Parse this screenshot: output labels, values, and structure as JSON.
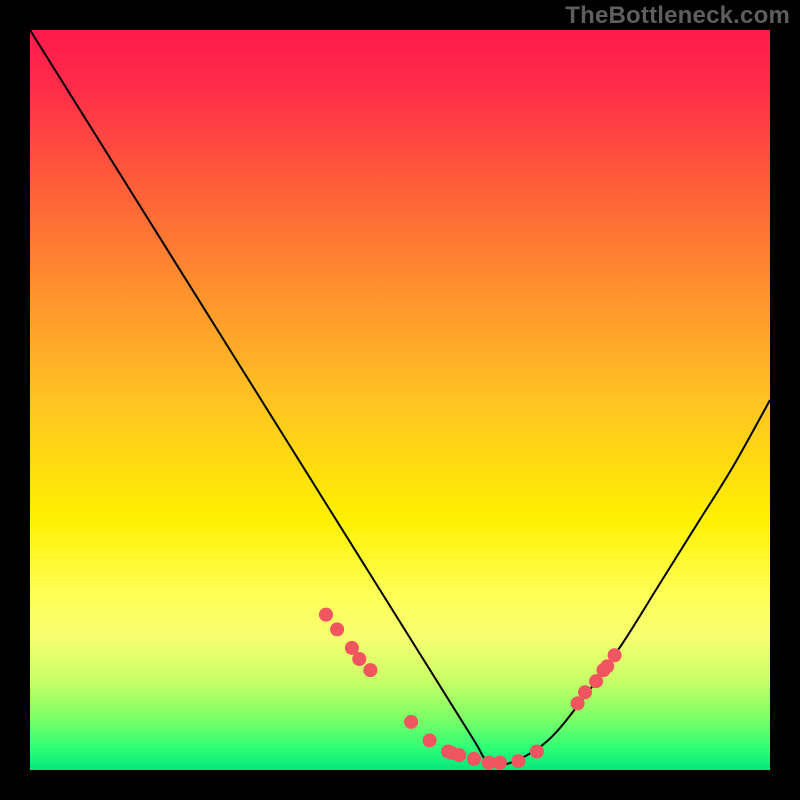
{
  "watermark": "TheBottleneck.com",
  "chart_data": {
    "type": "line",
    "title": "",
    "xlabel": "",
    "ylabel": "",
    "xlim": [
      0,
      100
    ],
    "ylim": [
      0,
      100
    ],
    "grid": false,
    "series": [
      {
        "name": "bottleneck-curve",
        "x": [
          0,
          5,
          10,
          15,
          20,
          25,
          30,
          35,
          40,
          45,
          50,
          55,
          60,
          62,
          65,
          70,
          75,
          80,
          85,
          90,
          95,
          100
        ],
        "values": [
          100,
          92,
          84,
          76,
          68,
          60,
          52,
          44,
          36,
          28,
          20,
          12,
          4,
          1,
          1,
          4,
          10,
          17,
          25,
          33,
          41,
          50
        ]
      }
    ],
    "markers": {
      "name": "highlight-dots",
      "color": "#f1555f",
      "x": [
        40.0,
        41.5,
        43.5,
        44.5,
        46.0,
        51.5,
        54.0,
        56.5,
        57.0,
        58.0,
        60.0,
        62.0,
        63.5,
        66.0,
        68.5,
        74.0,
        75.0,
        76.5,
        77.5,
        78.0,
        79.0
      ],
      "values": [
        21.0,
        19.0,
        16.5,
        15.0,
        13.5,
        6.5,
        4.0,
        2.5,
        2.3,
        2.0,
        1.5,
        1.0,
        1.0,
        1.2,
        2.5,
        9.0,
        10.5,
        12.0,
        13.5,
        14.0,
        15.5
      ]
    },
    "gradient_stops": [
      {
        "pos": 0,
        "color": "#ff1a4b"
      },
      {
        "pos": 8,
        "color": "#ff2d49"
      },
      {
        "pos": 20,
        "color": "#ff5a3a"
      },
      {
        "pos": 34,
        "color": "#ff8d2e"
      },
      {
        "pos": 50,
        "color": "#ffc322"
      },
      {
        "pos": 66,
        "color": "#fff000"
      },
      {
        "pos": 76,
        "color": "#ffff55"
      },
      {
        "pos": 82,
        "color": "#f7ff70"
      },
      {
        "pos": 88,
        "color": "#c8ff66"
      },
      {
        "pos": 93,
        "color": "#7dff66"
      },
      {
        "pos": 97,
        "color": "#2eff77"
      },
      {
        "pos": 100,
        "color": "#03e67a"
      }
    ]
  }
}
